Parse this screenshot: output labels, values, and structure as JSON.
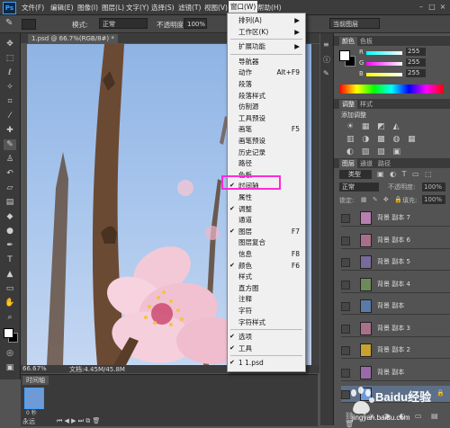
{
  "app": {
    "logo": "Ps"
  },
  "menubar": {
    "items": [
      "文件(F)",
      "编辑(E)",
      "图像(I)",
      "图层(L)",
      "文字(Y)",
      "选择(S)",
      "滤镜(T)",
      "视图(V)",
      "窗口(W)",
      "帮助(H)"
    ]
  },
  "options": {
    "mode_label": "模式:",
    "mode_value": "正常",
    "opacity_label": "不透明度:",
    "opacity_value": "100%",
    "workspace_value": "当前图层"
  },
  "document": {
    "tab": "1.psd @ 66.7%(RGB/8#) *",
    "zoom": "66.67%",
    "doc_info": "文档:4.45M/45.8M"
  },
  "window_menu": {
    "items": [
      {
        "label": "排列(A)",
        "shortcut": "▶",
        "checked": false
      },
      {
        "label": "工作区(K)",
        "shortcut": "▶",
        "checked": false
      },
      {
        "label": "扩展功能",
        "shortcut": "▶",
        "checked": false
      },
      {
        "label": "导航器",
        "shortcut": "",
        "checked": false
      },
      {
        "label": "动作",
        "shortcut": "Alt+F9",
        "checked": false
      },
      {
        "label": "段落",
        "shortcut": "",
        "checked": false
      },
      {
        "label": "段落样式",
        "shortcut": "",
        "checked": false
      },
      {
        "label": "仿制源",
        "shortcut": "",
        "checked": false
      },
      {
        "label": "工具预设",
        "shortcut": "",
        "checked": false
      },
      {
        "label": "画笔",
        "shortcut": "F5",
        "checked": false
      },
      {
        "label": "画笔预设",
        "shortcut": "",
        "checked": false
      },
      {
        "label": "历史记录",
        "shortcut": "",
        "checked": false
      },
      {
        "label": "路径",
        "shortcut": "",
        "checked": false
      },
      {
        "label": "色板",
        "shortcut": "",
        "checked": false
      },
      {
        "label": "时间轴",
        "shortcut": "",
        "checked": true
      },
      {
        "label": "属性",
        "shortcut": "",
        "checked": false
      },
      {
        "label": "调整",
        "shortcut": "",
        "checked": true
      },
      {
        "label": "通道",
        "shortcut": "",
        "checked": false
      },
      {
        "label": "图层",
        "shortcut": "F7",
        "checked": true
      },
      {
        "label": "图层复合",
        "shortcut": "",
        "checked": false
      },
      {
        "label": "信息",
        "shortcut": "F8",
        "checked": false
      },
      {
        "label": "颜色",
        "shortcut": "F6",
        "checked": true
      },
      {
        "label": "样式",
        "shortcut": "",
        "checked": false
      },
      {
        "label": "直方图",
        "shortcut": "",
        "checked": false
      },
      {
        "label": "注释",
        "shortcut": "",
        "checked": false
      },
      {
        "label": "字符",
        "shortcut": "",
        "checked": false
      },
      {
        "label": "字符样式",
        "shortcut": "",
        "checked": false
      },
      {
        "label": "选项",
        "shortcut": "",
        "checked": true
      },
      {
        "label": "工具",
        "shortcut": "",
        "checked": true
      },
      {
        "label": "1 1.psd",
        "shortcut": "",
        "checked": true
      }
    ]
  },
  "color_panel": {
    "tabs": [
      "颜色",
      "色板"
    ],
    "r_label": "R",
    "g_label": "G",
    "b_label": "B",
    "r": "255",
    "g": "255",
    "b": "255"
  },
  "adjust_panel": {
    "tabs": [
      "调整",
      "样式"
    ],
    "add_label": "添加调整"
  },
  "layers_panel": {
    "tabs": [
      "图层",
      "通道",
      "路径"
    ],
    "filter_kind": "类型",
    "blend_mode": "正常",
    "opacity_label": "不透明度:",
    "opacity_value": "100%",
    "lock_label": "锁定:",
    "fill_label": "填充:",
    "fill_value": "100%",
    "layers": [
      {
        "name": "背景 副本 7",
        "thumb_color": "#b77fae"
      },
      {
        "name": "背景 副本 6",
        "thumb_color": "#a86f8a"
      },
      {
        "name": "背景 副本 5",
        "thumb_color": "#7a6a9c"
      },
      {
        "name": "背景 副本 4",
        "thumb_color": "#6f8a5a"
      },
      {
        "name": "背景 副本",
        "thumb_color": "#5a7aa8"
      },
      {
        "name": "背景 副本 3",
        "thumb_color": "#a8708a"
      },
      {
        "name": "背景 副本 2",
        "thumb_color": "#c9a12f"
      },
      {
        "name": "背景 副本",
        "thumb_color": "#9a6aa8"
      },
      {
        "name": "",
        "thumb_color": "#6f9ad8"
      }
    ]
  },
  "timeline": {
    "tab": "时间轴",
    "frame_delay": "0 秒",
    "loop": "永远"
  },
  "watermark": {
    "brand": "Baidu经验",
    "url": "jingyan.baidu.com"
  }
}
